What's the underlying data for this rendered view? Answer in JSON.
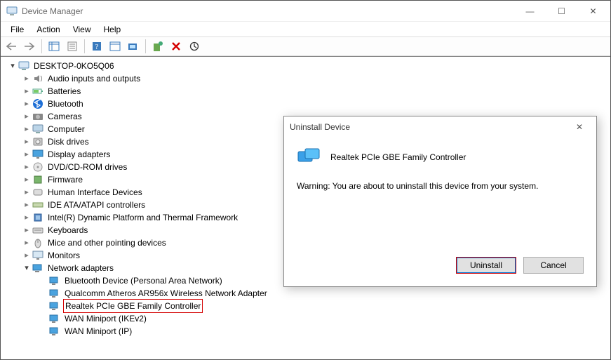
{
  "window": {
    "title": "Device Manager",
    "controls": {
      "min": "—",
      "max": "☐",
      "close": "✕"
    }
  },
  "menubar": [
    "File",
    "Action",
    "View",
    "Help"
  ],
  "toolbar": [
    {
      "name": "back-icon"
    },
    {
      "name": "forward-icon"
    },
    {
      "sep": true
    },
    {
      "name": "show-hidden-icon"
    },
    {
      "name": "properties-icon"
    },
    {
      "sep": true
    },
    {
      "name": "help-icon"
    },
    {
      "name": "scan-icon"
    },
    {
      "name": "update-driver-icon"
    },
    {
      "sep": true
    },
    {
      "name": "uninstall-icon"
    },
    {
      "name": "disable-icon"
    },
    {
      "name": "refresh-icon"
    }
  ],
  "tree": {
    "root": {
      "label": "DESKTOP-0KO5Q06",
      "expanded": true,
      "icon": "computer"
    },
    "items": [
      {
        "label": "Audio inputs and outputs",
        "icon": "audio",
        "expanded": false
      },
      {
        "label": "Batteries",
        "icon": "battery",
        "expanded": false
      },
      {
        "label": "Bluetooth",
        "icon": "bluetooth",
        "expanded": false
      },
      {
        "label": "Cameras",
        "icon": "camera",
        "expanded": false
      },
      {
        "label": "Computer",
        "icon": "computer",
        "expanded": false
      },
      {
        "label": "Disk drives",
        "icon": "disk",
        "expanded": false
      },
      {
        "label": "Display adapters",
        "icon": "display",
        "expanded": false
      },
      {
        "label": "DVD/CD-ROM drives",
        "icon": "cd",
        "expanded": false
      },
      {
        "label": "Firmware",
        "icon": "firmware",
        "expanded": false
      },
      {
        "label": "Human Interface Devices",
        "icon": "hid",
        "expanded": false
      },
      {
        "label": "IDE ATA/ATAPI controllers",
        "icon": "ide",
        "expanded": false
      },
      {
        "label": "Intel(R) Dynamic Platform and Thermal Framework",
        "icon": "chip",
        "expanded": false
      },
      {
        "label": "Keyboards",
        "icon": "keyboard",
        "expanded": false
      },
      {
        "label": "Mice and other pointing devices",
        "icon": "mouse",
        "expanded": false
      },
      {
        "label": "Monitors",
        "icon": "monitor",
        "expanded": false
      },
      {
        "label": "Network adapters",
        "icon": "network",
        "expanded": true
      }
    ],
    "netItems": [
      {
        "label": "Bluetooth Device (Personal Area Network)",
        "icon": "netadapter"
      },
      {
        "label": "Qualcomm Atheros AR956x Wireless Network Adapter",
        "icon": "netadapter"
      },
      {
        "label": "Realtek PCIe GBE Family Controller",
        "icon": "netadapter",
        "highlighted": true
      },
      {
        "label": "WAN Miniport (IKEv2)",
        "icon": "netadapter"
      },
      {
        "label": "WAN Miniport (IP)",
        "icon": "netadapter"
      }
    ]
  },
  "dialog": {
    "title": "Uninstall Device",
    "deviceName": "Realtek PCIe GBE Family Controller",
    "warning": "Warning: You are about to uninstall this device from your system.",
    "buttons": {
      "ok": "Uninstall",
      "cancel": "Cancel"
    },
    "close": "✕"
  }
}
